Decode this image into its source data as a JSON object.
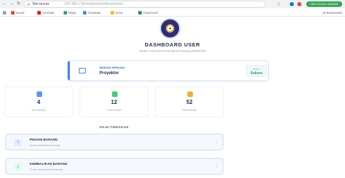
{
  "browser": {
    "url_site": "Not secure",
    "url_path": "192.168.1.9/inventaris/dashboard/user",
    "update_label": "New Chrome available",
    "bookmarks": [
      "Gmail",
      "YouTube",
      "Maps",
      "Translate",
      "Drive",
      "Classroom"
    ],
    "all_bookmarks": "All Bookmarks"
  },
  "header": {
    "title": "DASHBOARD USER",
    "subtitle": "Sistem Informasi Peminjaman Barang Elektronik"
  },
  "info_card": {
    "label": "BARANG DIPINJAM",
    "value": "Proyektor",
    "status_label": "Status",
    "status_value": "Sukses"
  },
  "stats": [
    {
      "value": "4",
      "label": "Total dipinjam",
      "color": "#3b82f6"
    },
    {
      "value": "12",
      "label": "Total tersedia",
      "color": "#22c55e"
    },
    {
      "value": "52",
      "label": "Dikembalikan",
      "color": "#f59e0b"
    }
  ],
  "section_title": "PILIH TINDAKAN",
  "actions": [
    {
      "title": "PINJAM BARANG",
      "subtitle": "Ajukan peminjaman barang",
      "icon": "arrow-up-icon",
      "color": "#2563eb"
    },
    {
      "title": "KEMBALIKAN BARANG",
      "subtitle": "Proses pengembalian barang",
      "icon": "arrow-down-icon",
      "color": "#16a34a"
    }
  ],
  "colors": {
    "accent": "#3b82f6",
    "brand": "#2b2f77",
    "status_success": "#16a34a"
  }
}
